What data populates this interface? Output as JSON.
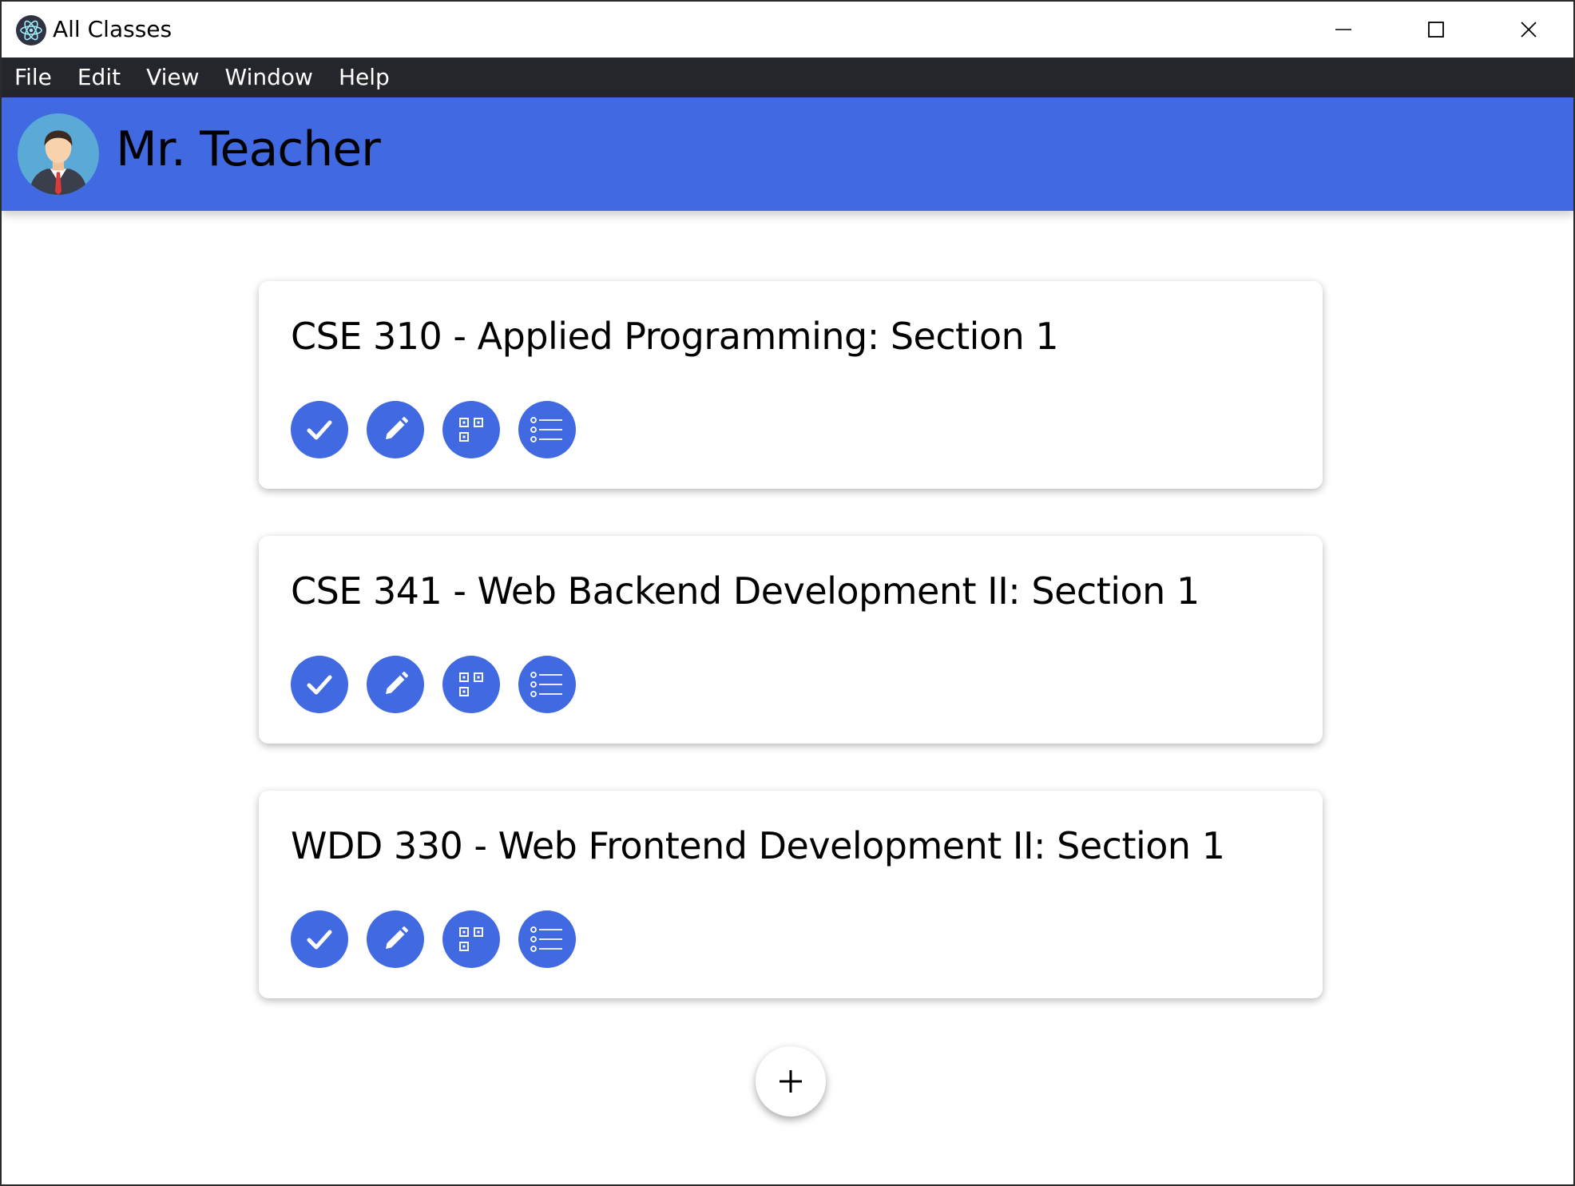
{
  "window": {
    "title": "All Classes",
    "controls": {
      "minimize": "minimize-icon",
      "maximize": "maximize-icon",
      "close": "close-icon"
    }
  },
  "menu": {
    "items": [
      {
        "label": "File"
      },
      {
        "label": "Edit"
      },
      {
        "label": "View"
      },
      {
        "label": "Window"
      },
      {
        "label": "Help"
      }
    ]
  },
  "header": {
    "teacher_name": "Mr. Teacher",
    "background_color": "#4169e1"
  },
  "classes": [
    {
      "title": "CSE 310 - Applied Programming: Section 1"
    },
    {
      "title": "CSE 341 - Web Backend Development II: Section 1"
    },
    {
      "title": "WDD 330 - Web Frontend Development II: Section 1"
    }
  ],
  "card_actions": [
    {
      "icon": "check-icon"
    },
    {
      "icon": "pencil-icon"
    },
    {
      "icon": "qr-code-icon"
    },
    {
      "icon": "list-icon"
    }
  ],
  "add_button": {
    "icon": "plus-icon"
  },
  "colors": {
    "accent": "#4169e1",
    "menubar": "#25262b"
  }
}
